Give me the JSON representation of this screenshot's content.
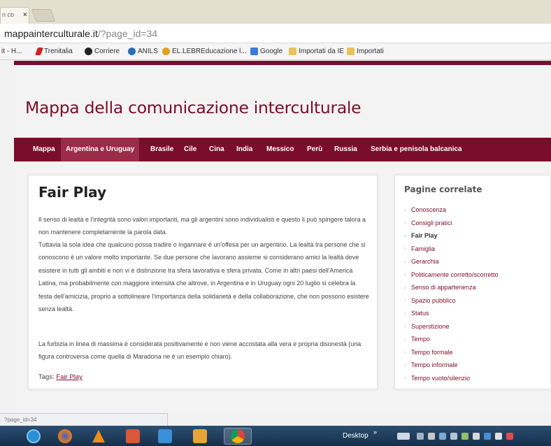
{
  "browser": {
    "tab_title": "n co",
    "tab_close": "×",
    "url_host": "mappainterculturale.it",
    "url_path": "/?page_id=34",
    "bookmarks": [
      {
        "label": "it - H...",
        "icon": "bookmark-icon",
        "color": "#888888"
      },
      {
        "label": "Trenitalia",
        "icon": "trenitalia-icon",
        "color": "#cc2222"
      },
      {
        "label": "Corriere",
        "icon": "corriere-icon",
        "color": "#222222"
      },
      {
        "label": "ANILS",
        "icon": "anils-icon",
        "color": "#2a6fb8"
      },
      {
        "label": "EL.LEBREducazione l...",
        "icon": "ellebr-icon",
        "color": "#e0a020"
      },
      {
        "label": "Google",
        "icon": "google-icon",
        "color": "#3a7ad9"
      },
      {
        "label": "Importati da IE",
        "icon": "folder-icon",
        "color": "#e8c25a"
      },
      {
        "label": "Importati",
        "icon": "folder-icon",
        "color": "#e8c25a"
      }
    ]
  },
  "site": {
    "title": "Mappa della comunicazione interculturale",
    "accent_color": "#7a0d2b",
    "nav": [
      {
        "label": "Mappa",
        "active": false
      },
      {
        "label": "Argentina e Uruguay",
        "active": true
      },
      {
        "label": "Brasile",
        "active": false
      },
      {
        "label": "Cile",
        "active": false
      },
      {
        "label": "Cina",
        "active": false
      },
      {
        "label": "India",
        "active": false
      },
      {
        "label": "Messico",
        "active": false
      },
      {
        "label": "Perù",
        "active": false
      },
      {
        "label": "Russia",
        "active": false
      },
      {
        "label": "Serbia e penisola balcanica",
        "active": false
      }
    ]
  },
  "article": {
    "title": "Fair Play",
    "paragraph1": "Il senso di lealtà e l'integrità sono valori importanti, ma gli argentini sono individualisti e questo li può spingere talora a non mantenere completamente la parola data.",
    "paragraph2": "Tuttavia la sola idea che qualcuno possa tradire o ingannare è un'offesa per un argentino. La lealtà tra persone che si conoscono è un valore molto importante. Se due persone che lavorano assieme si considerano amici la lealtà deve esistere in tutti gli ambiti e non vi è distinzione tra sfera lavorativa e sfera privata. Come in altri paesi dell'America Latina, ma probabilmente con maggiore intensità che altrove, in Argentina e in Uruguay ogni 20 luglio si celebra la festa dell'amicizia, proprio a sottolineare l'importanza della solidarietà e della collaborazione, che non possono esistere senza lealtà.",
    "paragraph3": "La furbizia in linea di massima è considerata positivamente e non viene accostata alla vera e propria disonestà (una figura controversa come quella di Maradona ne è un esempio chiaro).",
    "tags_label": "Tags:",
    "tag": "Fair Play"
  },
  "sidebar": {
    "title": "Pagine correlate",
    "items": [
      {
        "label": "Conoscenza",
        "current": false
      },
      {
        "label": "Consigli pratici",
        "current": false
      },
      {
        "label": "Fair Play",
        "current": true
      },
      {
        "label": "Famiglia",
        "current": false
      },
      {
        "label": "Gerarchia",
        "current": false
      },
      {
        "label": "Politicamente corretto/scorretto",
        "current": false
      },
      {
        "label": "Senso di appartenenza",
        "current": false
      },
      {
        "label": "Spazio pubblico",
        "current": false
      },
      {
        "label": "Status",
        "current": false
      },
      {
        "label": "Superstizione",
        "current": false
      },
      {
        "label": "Tempo",
        "current": false
      },
      {
        "label": "Tempo formale",
        "current": false
      },
      {
        "label": "Tempo informale",
        "current": false
      },
      {
        "label": "Tempo vuoto/silenzio",
        "current": false
      }
    ]
  },
  "status_text": "?page_id=34",
  "taskbar": {
    "desktop_label": "Desktop",
    "apps": [
      "internet-explorer-icon",
      "firefox-icon",
      "vlc-icon",
      "presentation-icon",
      "media-player-icon",
      "image-viewer-icon",
      "chrome-icon"
    ]
  }
}
